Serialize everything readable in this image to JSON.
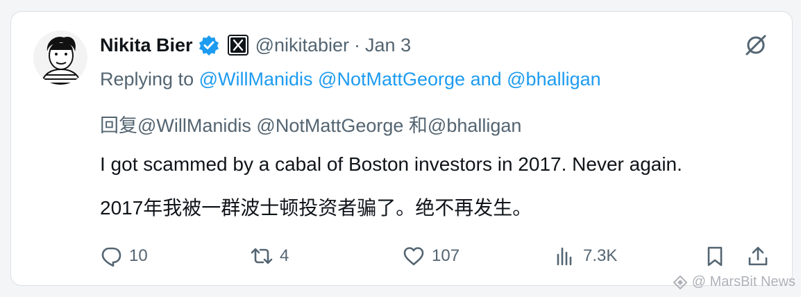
{
  "author": {
    "name": "Nikita Bier",
    "handle": "@nikitabier",
    "separator": "·",
    "date": "Jan 3",
    "verified_color": "#1d9bf0"
  },
  "reply": {
    "prefix": "Replying to ",
    "mention1": "@WillManidis",
    "mention2": "@NotMattGeorge",
    "conj": "and",
    "mention3": "@bhalligan"
  },
  "cn_reply": "回复@WillManidis @NotMattGeorge 和@bhalligan",
  "tweet": {
    "text_en": "I got scammed by a cabal of Boston investors in 2017. Never again.",
    "text_cn": "2017年我被一群波士顿投资者骗了。绝不再发生。"
  },
  "actions": {
    "replies": "10",
    "retweets": "4",
    "likes": "107",
    "views": "7.3K"
  },
  "icons": {
    "reply": "reply-icon",
    "retweet": "retweet-icon",
    "like": "heart-icon",
    "views": "views-icon",
    "bookmark": "bookmark-icon",
    "share": "share-icon",
    "grok": "grok-icon"
  },
  "watermark": "@ MarsBit News",
  "colors": {
    "link": "#1d9bf0",
    "secondary": "#536471",
    "text": "#0f1419"
  }
}
